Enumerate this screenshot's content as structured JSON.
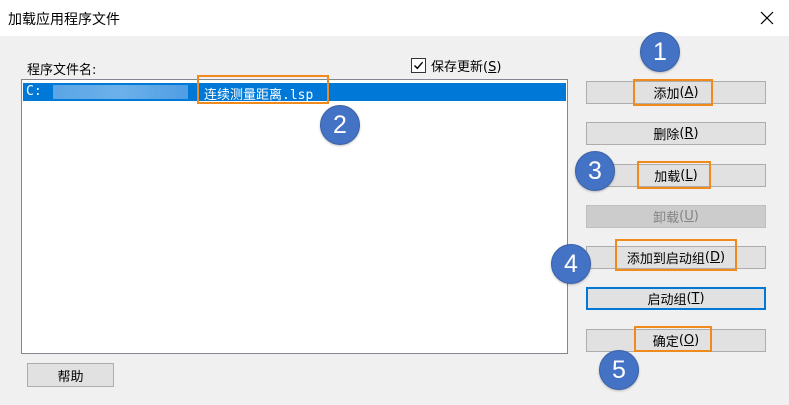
{
  "window": {
    "title": "加载应用程序文件",
    "close_glyph": "✕"
  },
  "list": {
    "label": "程序文件名:",
    "selected_row": {
      "drive": "C:",
      "file": "连续测量距离.lsp"
    }
  },
  "save_updates": {
    "label": "保存更新",
    "key": "S",
    "checked": true
  },
  "buttons": {
    "add": {
      "label": "添加",
      "key": "A"
    },
    "delete": {
      "label": "删除",
      "key": "R"
    },
    "load": {
      "label": "加载",
      "key": "L"
    },
    "unload": {
      "label": "卸载",
      "key": "U"
    },
    "add_startup": {
      "label": "添加到启动组",
      "key": "D"
    },
    "startup": {
      "label": "启动组",
      "key": "T"
    },
    "ok": {
      "label": "确定",
      "key": "O"
    },
    "help": {
      "label": "帮助"
    }
  },
  "annotations": {
    "step1": "1",
    "step2": "2",
    "step3": "3",
    "step4": "4",
    "step5": "5",
    "badge_color": "#4472c4",
    "highlight_color": "#f08a1c"
  },
  "colors": {
    "selection": "#0078d7",
    "dialog_bg": "#f0f0f0"
  }
}
